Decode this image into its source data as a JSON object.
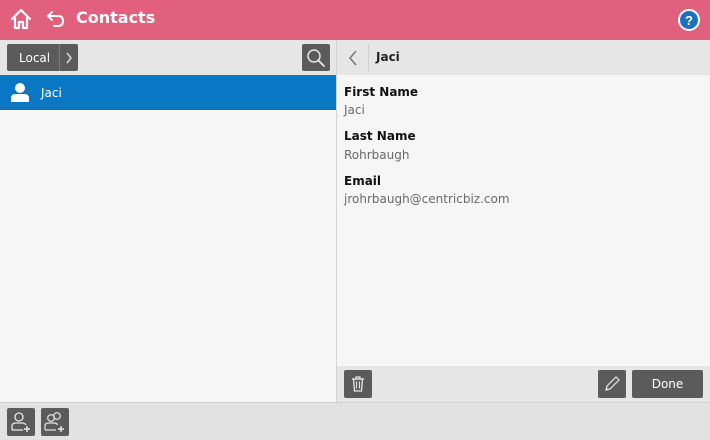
{
  "header": {
    "title": "Contacts",
    "home_icon": "home-icon",
    "back_icon": "back-arrow-icon",
    "help_label": "?",
    "background_color": "#e0607e"
  },
  "left_pane": {
    "source_label": "Local",
    "source_chevron_icon": "chevron-right-icon",
    "search_icon": "search-icon",
    "contacts": [
      {
        "name": "Jaci",
        "selected": true,
        "icon": "person-icon"
      }
    ],
    "selected_color": "#0a77c4"
  },
  "detail": {
    "title": "Jaci",
    "back_icon": "chevron-left-icon",
    "fields": [
      {
        "label": "First Name",
        "value": "Jaci"
      },
      {
        "label": "Last Name",
        "value": "Rohrbaugh"
      },
      {
        "label": "Email",
        "value": "jrohrbaugh@centricbiz.com"
      }
    ],
    "delete_icon": "trash-icon",
    "edit_icon": "pencil-icon",
    "done_label": "Done"
  },
  "bottom_bar": {
    "add_contact_icon": "add-contact-icon",
    "add_group_icon": "add-group-icon"
  }
}
